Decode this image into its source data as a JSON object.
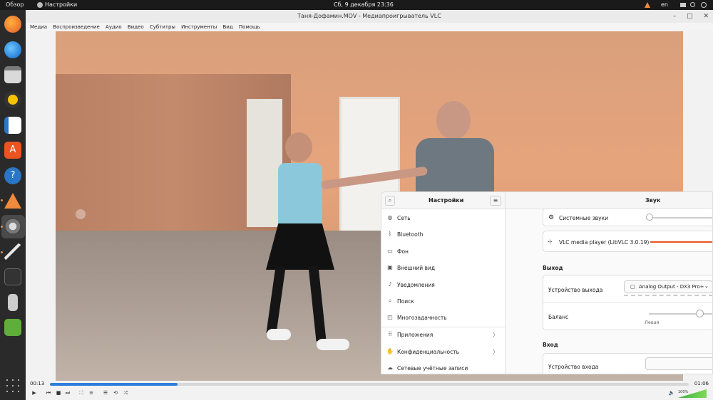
{
  "topbar": {
    "overview": "Обзор",
    "app": "Настройки",
    "clock": "Сб, 9 декабря  23:36",
    "lang": "en"
  },
  "vlc": {
    "title": "Таня-Дофамин.MOV - Медиапроигрыватель VLC",
    "menu": [
      "Медиа",
      "Воспроизведение",
      "Аудио",
      "Видео",
      "Субтитры",
      "Инструменты",
      "Вид",
      "Помощь"
    ],
    "time_elapsed": "00:13",
    "time_total": "01:06",
    "progress": 0.2,
    "volume_label": "100%",
    "volume": 1.0
  },
  "settings": {
    "sidebar_title": "Настройки",
    "page_title": "Звук",
    "items": [
      {
        "label": "Сеть",
        "icon": "globe-icon"
      },
      {
        "label": "Bluetooth",
        "icon": "bluetooth-icon"
      },
      {
        "label": "Фон",
        "icon": "background-icon"
      },
      {
        "label": "Внешний вид",
        "icon": "appearance-icon"
      },
      {
        "label": "Уведомления",
        "icon": "bell-icon"
      },
      {
        "label": "Поиск",
        "icon": "search-icon"
      },
      {
        "label": "Многозадачность",
        "icon": "multitasking-icon"
      },
      {
        "label": "Приложения",
        "icon": "apps-icon",
        "chevron": true
      },
      {
        "label": "Конфиденциальность",
        "icon": "hand-icon",
        "chevron": true
      },
      {
        "label": "Сетевые учётные записи",
        "icon": "cloud-icon"
      }
    ],
    "system_sounds": "Системные звуки",
    "vlc_stream": "VLC media player (LibVLC 3.0.19)",
    "output_section": "Выход",
    "output_device_label": "Устройство выхода",
    "output_device_value": "Analog Output - DX3 Pro+",
    "balance_label": "Баланс",
    "balance_left": "Левая",
    "input_section": "Вход",
    "input_device_label": "Устройство входа"
  }
}
